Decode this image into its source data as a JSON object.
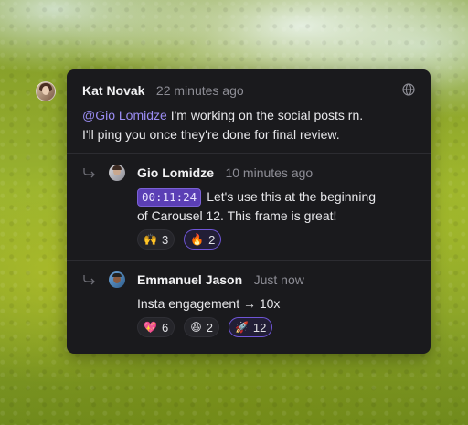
{
  "thread": {
    "root": {
      "author": "Kat Novak",
      "time": "22 minutes ago",
      "mention": "@Gio Lomidze",
      "text_line1": " I'm working on the social posts rn.",
      "text_line2": "I'll ping you once they're done for final review.",
      "visibility_icon": "globe-icon"
    },
    "replies": [
      {
        "author": "Gio Lomidze",
        "time": "10 minutes ago",
        "timestamp": "00:11:24",
        "text_line1": "Let's use this at the beginning",
        "text_line2": "of Carousel 12. This frame is great!",
        "reactions": [
          {
            "emoji": "🙌",
            "emoji_name": "raised-hands",
            "count": "3",
            "mine": false
          },
          {
            "emoji": "🔥",
            "emoji_name": "fire",
            "count": "2",
            "mine": true
          }
        ]
      },
      {
        "author": "Emmanuel Jason",
        "time": "Just now",
        "text": "Insta engagement → 10x",
        "reactions": [
          {
            "emoji": "💖",
            "emoji_name": "sparkling-heart",
            "count": "6",
            "mine": false
          },
          {
            "emoji": "😆",
            "emoji_name": "grinning-squinting-face",
            "count": "2",
            "mine": false
          },
          {
            "emoji": "🚀",
            "emoji_name": "rocket",
            "count": "12",
            "mine": true
          }
        ]
      }
    ]
  },
  "colors": {
    "card_bg": "#1a1a1d",
    "mention": "#9a8cf2",
    "accent": "#6f55d6",
    "muted_text": "#8d8d95"
  }
}
